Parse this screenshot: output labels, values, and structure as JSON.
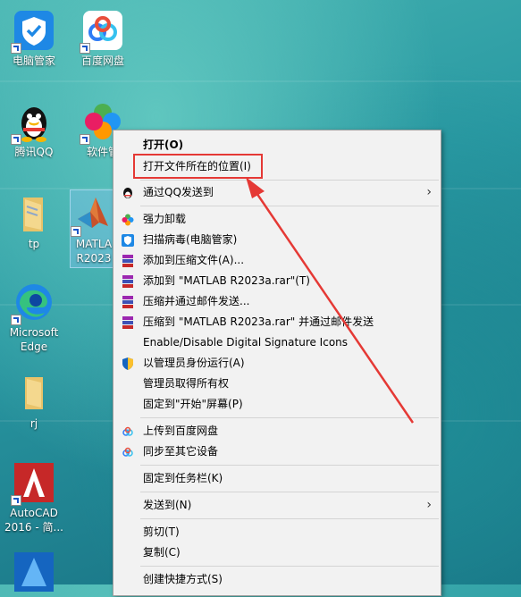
{
  "desktop": {
    "icons": [
      {
        "label": "电脑管家",
        "icon": "tencent-pc-manager-icon"
      },
      {
        "label": "百度网盘",
        "icon": "baidu-netdisk-icon"
      },
      {
        "label": "腾讯QQ",
        "icon": "qq-penguin-icon"
      },
      {
        "label": "软件管",
        "icon": "software-manager-icon"
      },
      {
        "label": "tp",
        "icon": "folder-icon"
      },
      {
        "label": "MATLA\nR2023",
        "icon": "matlab-icon"
      },
      {
        "label": "Microsoft\nEdge",
        "icon": "edge-icon"
      },
      {
        "label": "rj",
        "icon": "folder-icon"
      },
      {
        "label": "AutoCAD\n2016 - 简...",
        "icon": "autocad-icon"
      }
    ]
  },
  "context_menu": {
    "items": [
      {
        "label": "打开(O)"
      },
      {
        "label": "打开文件所在的位置(I)"
      },
      {
        "label": "通过QQ发送到"
      },
      {
        "label": "强力卸载"
      },
      {
        "label": "扫描病毒(电脑管家)"
      },
      {
        "label": "添加到压缩文件(A)..."
      },
      {
        "label": "添加到 \"MATLAB R2023a.rar\"(T)"
      },
      {
        "label": "压缩并通过邮件发送..."
      },
      {
        "label": "压缩到 \"MATLAB R2023a.rar\" 并通过邮件发送"
      },
      {
        "label": "Enable/Disable Digital Signature Icons"
      },
      {
        "label": "以管理员身份运行(A)"
      },
      {
        "label": "管理员取得所有权"
      },
      {
        "label": "固定到\"开始\"屏幕(P)"
      },
      {
        "label": "上传到百度网盘"
      },
      {
        "label": "同步至其它设备"
      },
      {
        "label": "固定到任务栏(K)"
      },
      {
        "label": "发送到(N)"
      },
      {
        "label": "剪切(T)"
      },
      {
        "label": "复制(C)"
      },
      {
        "label": "创建快捷方式(S)"
      }
    ],
    "submenu_arrow": "›"
  },
  "colors": {
    "annotation": "#e53935",
    "menu_bg": "#f2f2f2"
  }
}
